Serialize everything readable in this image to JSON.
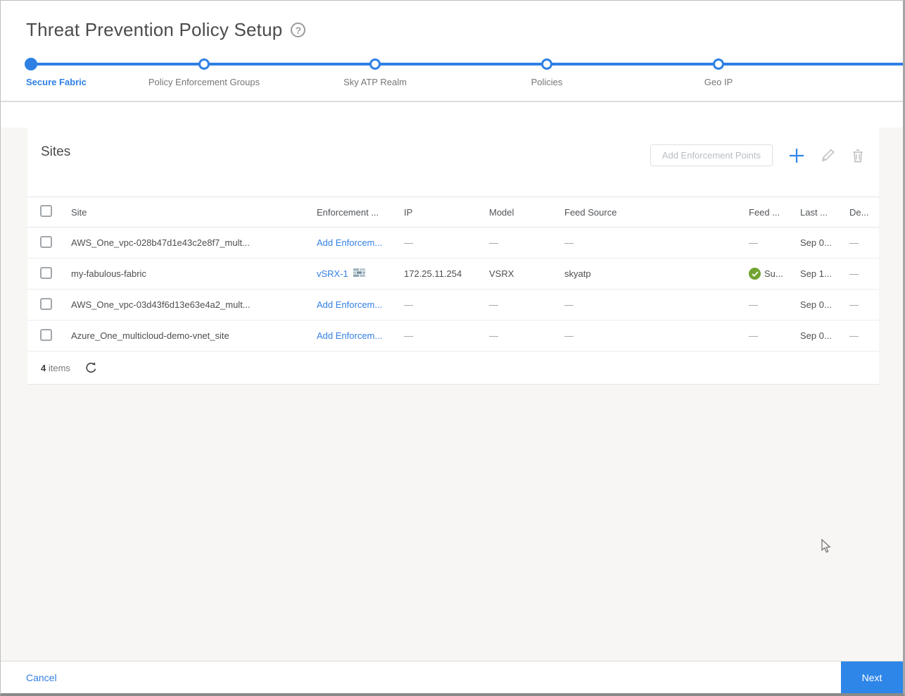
{
  "page": {
    "title": "Threat Prevention Policy Setup"
  },
  "stepper": {
    "steps": [
      {
        "label": "Secure Fabric",
        "state": "active"
      },
      {
        "label": "Policy Enforcement Groups",
        "state": "upcoming"
      },
      {
        "label": "Sky ATP Realm",
        "state": "upcoming"
      },
      {
        "label": "Policies",
        "state": "upcoming"
      },
      {
        "label": "Geo IP",
        "state": "upcoming"
      }
    ]
  },
  "sites_panel": {
    "title": "Sites",
    "actions": {
      "add_enforcement_points_label": "Add Enforcement Points",
      "icons": [
        "plus-icon",
        "pencil-icon",
        "trash-icon"
      ]
    },
    "table": {
      "columns": {
        "site": "Site",
        "enforcement": "Enforcement ...",
        "ip": "IP",
        "model": "Model",
        "feed_source": "Feed Source",
        "feed_status": "Feed ...",
        "last": "Last ...",
        "de": "De..."
      },
      "rows": [
        {
          "site": "AWS_One_vpc-028b47d1e43c2e8f7_mult...",
          "enforcement": "Add Enforcem...",
          "ip": "—",
          "model": "—",
          "feed_source": "—",
          "feed_status": "—",
          "last": "Sep 0...",
          "de": "—"
        },
        {
          "site": "my-fabulous-fabric",
          "enforcement": "vSRX-1",
          "ip": "172.25.11.254",
          "model": "VSRX",
          "feed_source": "skyatp",
          "feed_status": "Su...",
          "last": "Sep 1...",
          "de": "—"
        },
        {
          "site": "AWS_One_vpc-03d43f6d13e63e4a2_mult...",
          "enforcement": "Add Enforcem...",
          "ip": "—",
          "model": "—",
          "feed_source": "—",
          "feed_status": "—",
          "last": "Sep 0...",
          "de": "—"
        },
        {
          "site": "Azure_One_multicloud-demo-vnet_site",
          "enforcement": "Add Enforcem...",
          "ip": "—",
          "model": "—",
          "feed_source": "—",
          "feed_status": "—",
          "last": "Sep 0...",
          "de": "—"
        }
      ],
      "footer": {
        "count": "4",
        "count_label": "items"
      }
    }
  },
  "footer_bar": {
    "cancel_label": "Cancel",
    "next_label": "Next"
  },
  "colors": {
    "accent_blue": "#2e80e4",
    "link_blue": "#3380e4",
    "success_green": "#72a331",
    "page_bg": "#f7f6f4"
  }
}
